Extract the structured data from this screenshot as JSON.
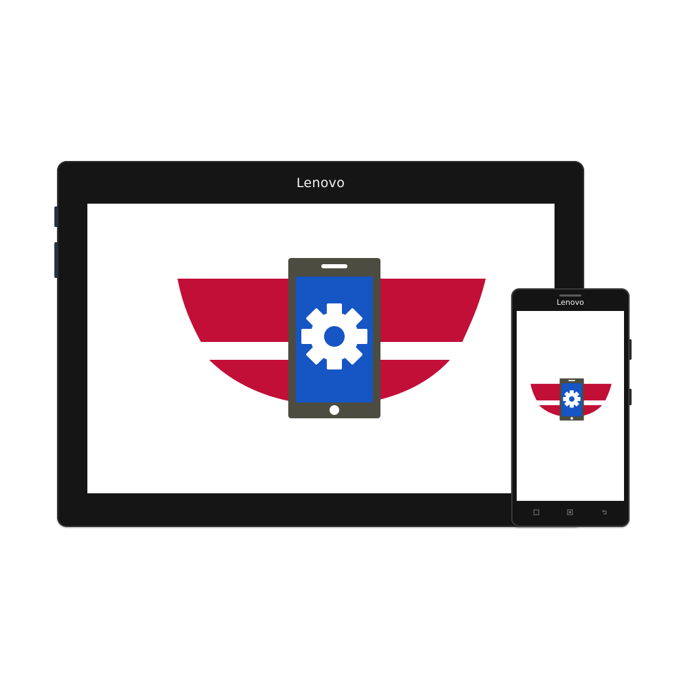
{
  "tablet": {
    "brand": "Lenovo"
  },
  "phone": {
    "brand": "Lenovo"
  },
  "colors": {
    "frame": "#151515",
    "screen": "#ffffff",
    "stripe_red": "#c20f38",
    "device_gray": "#4c4c40",
    "device_screen_blue": "#1655c4",
    "gear_white": "#ffffff"
  },
  "icons": {
    "app_logo": "phone-gear-icon",
    "phone_nav_recents": "menu-square-icon",
    "phone_nav_home": "home-square-icon",
    "phone_nav_back": "back-arrow-icon"
  }
}
